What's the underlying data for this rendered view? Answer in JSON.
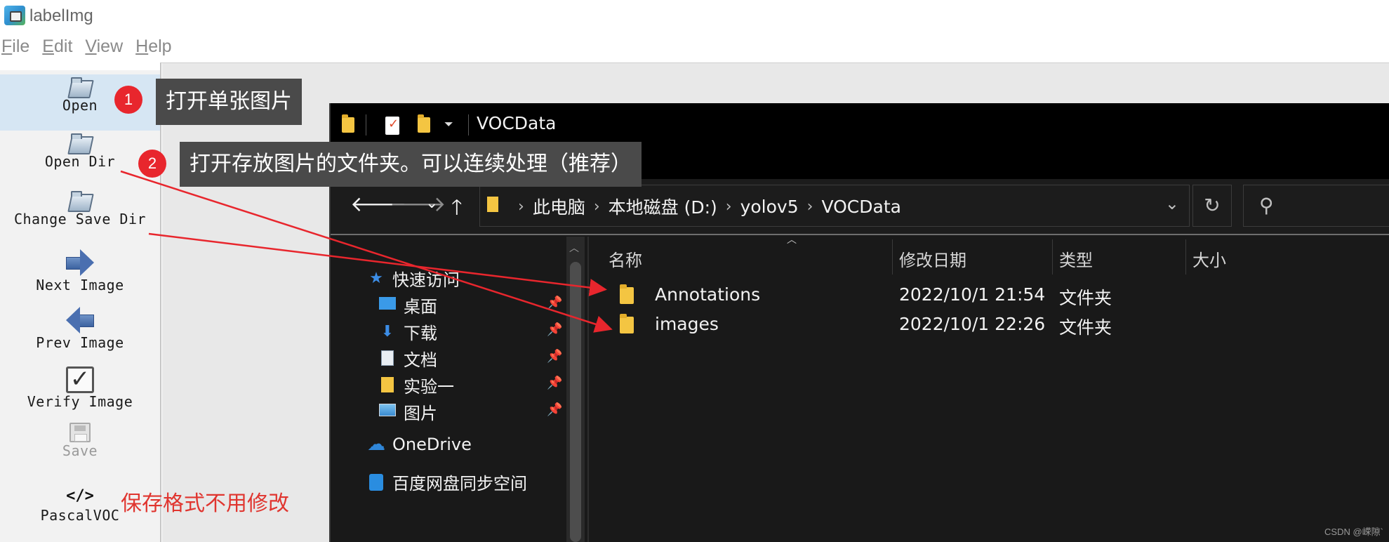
{
  "app": {
    "title": "labelImg"
  },
  "menu": [
    {
      "accel": "F",
      "rest": "ile"
    },
    {
      "accel": "E",
      "rest": "dit"
    },
    {
      "accel": "V",
      "rest": "iew"
    },
    {
      "accel": "H",
      "rest": "elp"
    }
  ],
  "toolbar": {
    "open": "Open",
    "open_dir": "Open Dir",
    "change_save_dir": "Change Save Dir",
    "next_image": "Next Image",
    "prev_image": "Prev Image",
    "verify_image": "Verify Image",
    "save": "Save",
    "format_icon": "</>",
    "format": "PascalVOC"
  },
  "annotations": {
    "badge_1": "1",
    "callout_1": "打开单张图片",
    "badge_2": "2",
    "callout_2": "打开存放图片的文件夹。可以连续处理（推荐）",
    "format_note": "保存格式不用修改",
    "arrow_color": "#e8262d"
  },
  "explorer": {
    "window_title": "VOCData",
    "breadcrumbs": [
      "此电脑",
      "本地磁盘 (D:)",
      "yolov5",
      "VOCData"
    ],
    "columns": {
      "name": "名称",
      "date": "修改日期",
      "type": "类型",
      "size": "大小"
    },
    "nav": {
      "quick_access": "快速访问",
      "desktop": "桌面",
      "downloads": "下载",
      "documents": "文档",
      "experiment": "实验一",
      "pictures": "图片",
      "onedrive": "OneDrive",
      "baidu": "百度网盘同步空间"
    },
    "files": [
      {
        "name": "Annotations",
        "date": "2022/10/1 21:54",
        "type": "文件夹"
      },
      {
        "name": "images",
        "date": "2022/10/1 22:26",
        "type": "文件夹"
      }
    ]
  },
  "watermark": "CSDN @嵘隙`"
}
